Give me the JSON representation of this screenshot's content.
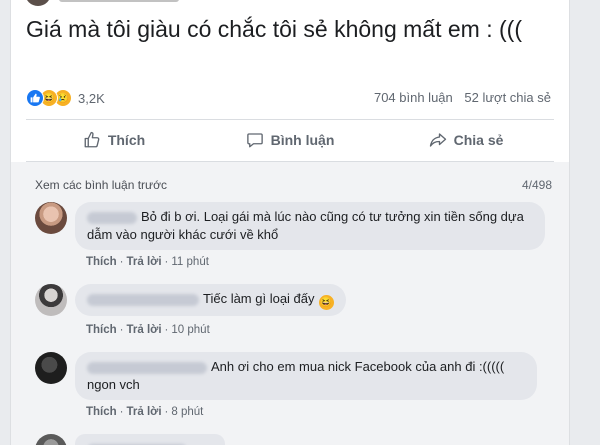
{
  "post": {
    "text": "Giá mà tôi giàu có chắc tôi sẻ không mất em : (((",
    "reaction_count": "3,2K",
    "comment_count": "704 bình luận",
    "share_count": "52 lượt chia sẻ"
  },
  "actions": {
    "like": "Thích",
    "comment": "Bình luận",
    "share": "Chia sẻ"
  },
  "comments_section": {
    "view_previous": "Xem các bình luận trước",
    "pager": "4/498",
    "items": [
      {
        "text": "Bỏ đi b ơi. Loại gái mà lúc nào cũng có tư tưởng xin tiền sống dựa dẫm vào người khác cưới về khổ",
        "like": "Thích",
        "reply": "Trả lời",
        "time": "11 phút"
      },
      {
        "text": "Tiếc làm gì loại đấy",
        "like": "Thích",
        "reply": "Trả lời",
        "time": "10 phút"
      },
      {
        "text": "Anh ơi cho em mua nick Facebook của anh đi :((((( ngon vch",
        "like": "Thích",
        "reply": "Trả lời",
        "time": "8 phút"
      }
    ]
  },
  "colors": {
    "brand": "#1877f2",
    "haha": "#f7b125",
    "bubble": "#e4e6eb"
  },
  "icons": [
    "like-icon",
    "haha-icon",
    "sad-icon",
    "thumbs-up-icon",
    "comment-icon",
    "share-icon"
  ]
}
